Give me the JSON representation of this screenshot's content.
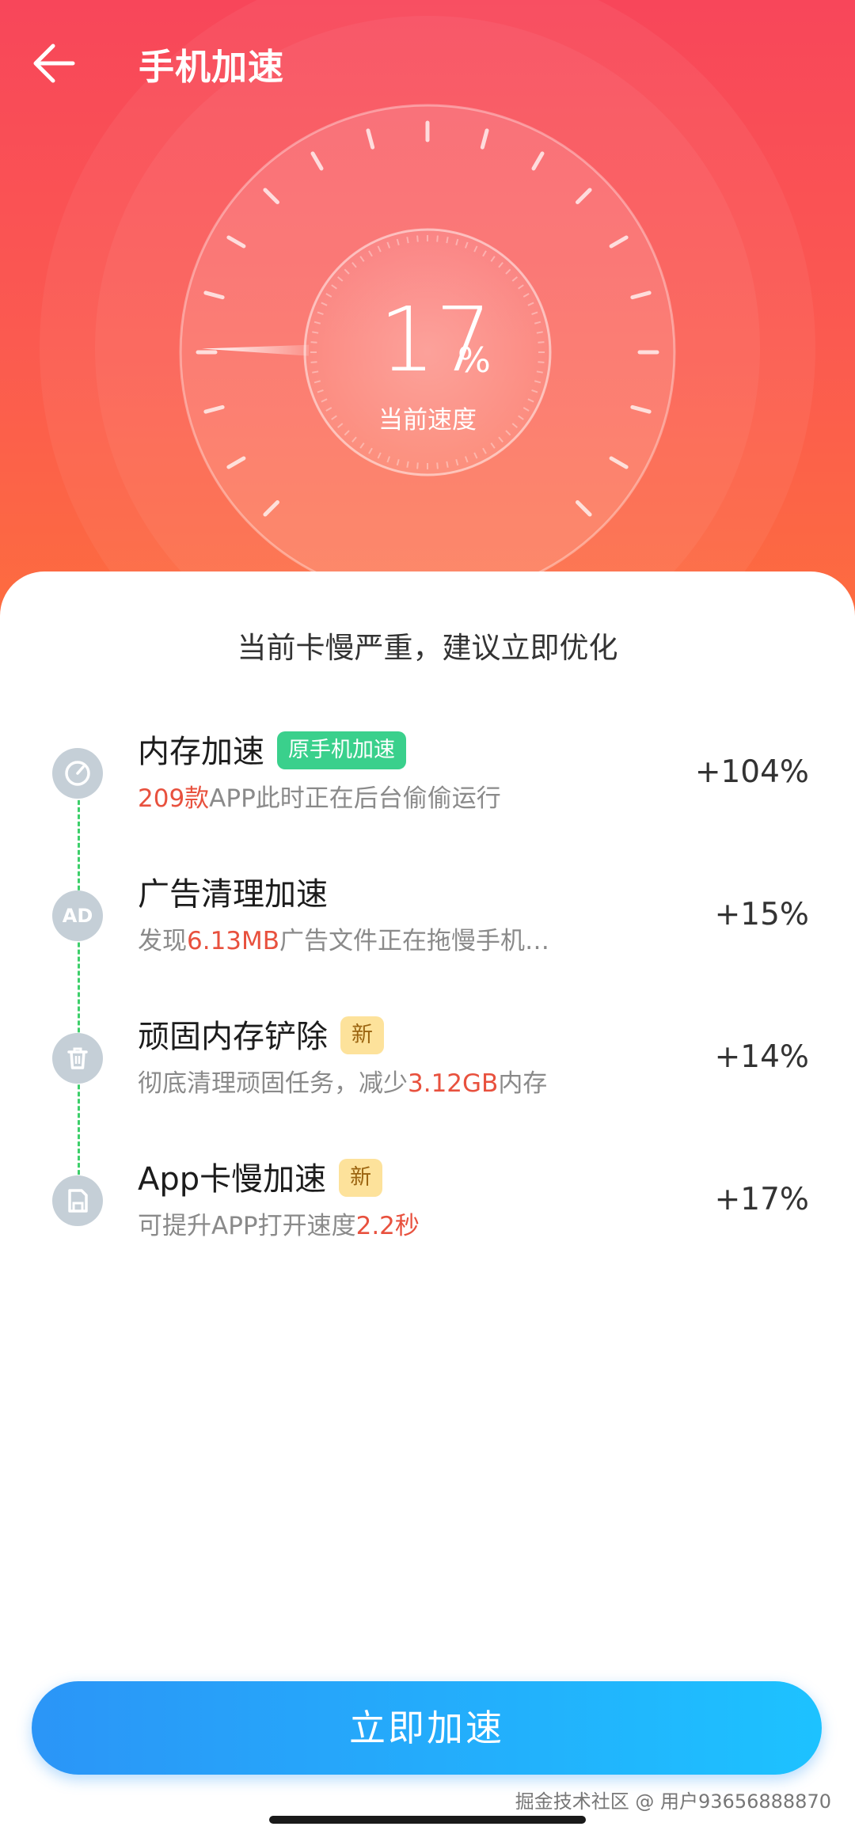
{
  "header": {
    "title": "手机加速"
  },
  "gauge": {
    "value": "17",
    "unit": "%",
    "label": "当前速度",
    "fraction": 0.17
  },
  "summary": "当前卡慢严重，建议立即优化",
  "items": [
    {
      "title": "内存加速",
      "badge": "原手机加速",
      "desc_highlight": "209款",
      "desc_rest": "APP此时正在后台偷偷运行",
      "gain": "+104%",
      "icon": "speedometer-icon"
    },
    {
      "title": "广告清理加速",
      "icon_text": "AD",
      "desc_pre": "发现",
      "desc_highlight": "6.13MB",
      "desc_rest": "广告文件正在拖慢手机…",
      "gain": "+15%",
      "icon": "ad-icon"
    },
    {
      "title": "顽固内存铲除",
      "badge": "新",
      "desc_pre": "彻底清理顽固任务，减少",
      "desc_highlight": "3.12GB",
      "desc_rest": "内存",
      "gain": "+14%",
      "icon": "trash-icon"
    },
    {
      "title": "App卡慢加速",
      "badge": "新",
      "desc_pre": "可提升APP打开速度",
      "desc_highlight": "2.2秒",
      "gain": "+17%",
      "icon": "app-file-icon"
    }
  ],
  "cta": {
    "label": "立即加速"
  },
  "watermark": "掘金技术社区 @ 用户93656888870",
  "colors": {
    "hero_top": "#f8465a",
    "hero_bottom": "#fd6c3f",
    "accent_red": "#e8513e",
    "badge_green": "#3ad08c",
    "cta_start": "#2b95f7",
    "cta_end": "#1dc2ff"
  }
}
